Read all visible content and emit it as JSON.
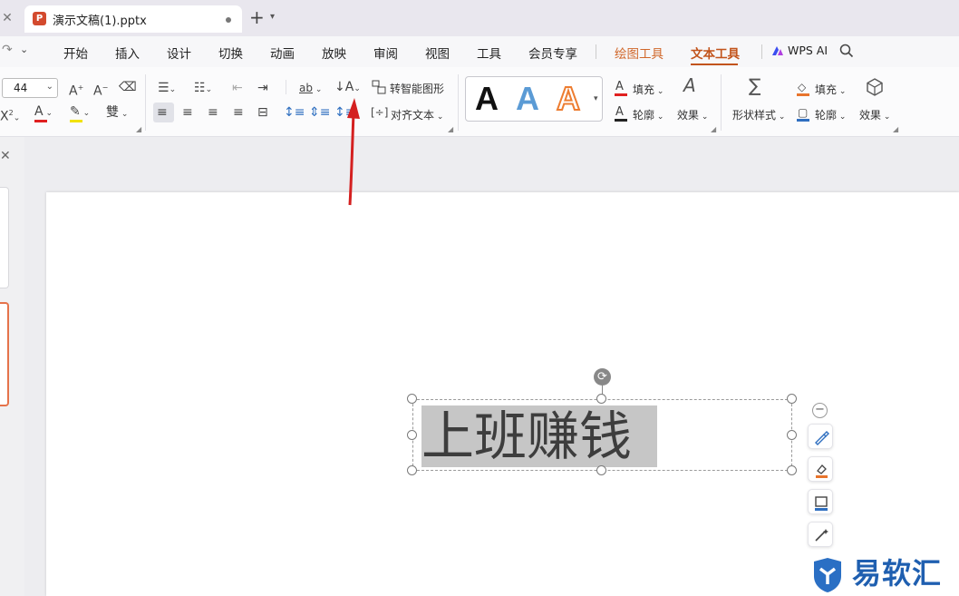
{
  "titlebar": {
    "left_close": "✕",
    "doc_icon": "P",
    "doc_title": "演示文稿(1).pptx",
    "new_tab": "+",
    "tab_menu": "⌄"
  },
  "menubar": {
    "items": [
      "开始",
      "插入",
      "设计",
      "切换",
      "动画",
      "放映",
      "审阅",
      "视图",
      "工具",
      "会员专享",
      "绘图工具",
      "文本工具",
      "WPS AI"
    ],
    "active": "文本工具"
  },
  "ribbon": {
    "font_size": "44",
    "smart_shape": "转智能图形",
    "align_text": "对齐文本",
    "fill_label": "填充",
    "outline_label": "轮廓",
    "effect_label": "效果",
    "shape_style_label": "形状样式",
    "shape_fill_label": "填充",
    "shape_outline_label": "轮廓",
    "shape_effect_label": "效果",
    "art_letters": [
      "A",
      "A",
      "A"
    ],
    "colors": {
      "font_color": "#e02020",
      "highlight": "#f2e200",
      "fill_red": "#e02020",
      "outline_black": "#222222",
      "shape_fill": "#e8742c",
      "shape_outline": "#2f6fc0",
      "art_blue": "#5b9bd5",
      "art_orange": "#ed7d31"
    }
  },
  "slide": {
    "text": "上班赚钱"
  },
  "watermark": {
    "text": "易软汇"
  }
}
